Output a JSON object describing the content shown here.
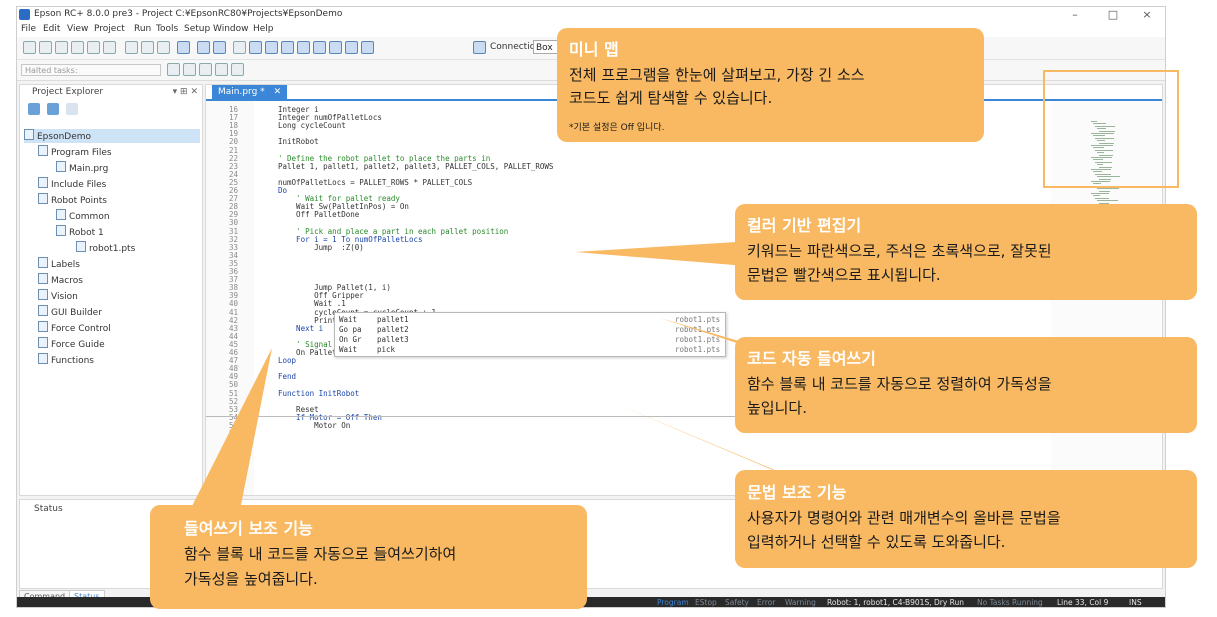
{
  "window": {
    "title": "Epson RC+ 8.0.0 pre3 - Project C:¥EpsonRC80¥Projects¥EpsonDemo",
    "minimize": "–",
    "maximize": "□",
    "close": "×"
  },
  "menu": [
    "File",
    "Edit",
    "View",
    "Project",
    "Run",
    "Tools",
    "Setup",
    "Window",
    "Help"
  ],
  "toolbar": {
    "connection_label": "Connection:",
    "connection_value": "Box"
  },
  "halted_tasks_placeholder": "Halted tasks:",
  "project_explorer": {
    "title": "Project Explorer",
    "pin": "▾ ⊞ ✕",
    "tree": [
      {
        "label": "EpsonDemo"
      },
      {
        "label": "Program Files"
      },
      {
        "label": "Main.prg"
      },
      {
        "label": "Include Files"
      },
      {
        "label": "Robot Points"
      },
      {
        "label": "Common"
      },
      {
        "label": "Robot 1"
      },
      {
        "label": "robot1.pts"
      },
      {
        "label": "Labels"
      },
      {
        "label": "Macros"
      },
      {
        "label": "Vision"
      },
      {
        "label": "GUI Builder"
      },
      {
        "label": "Force Control"
      },
      {
        "label": "Force Guide"
      },
      {
        "label": "Functions"
      }
    ]
  },
  "editor": {
    "tab_label": "Main.prg *",
    "tab_close": "✕",
    "line_numbers": [
      "16",
      "17",
      "18",
      "19",
      "20",
      "21",
      "22",
      "23",
      "24",
      "25",
      "26",
      "27",
      "28",
      "29",
      "30",
      "31",
      "32",
      "33",
      "34",
      "35",
      "36",
      "37",
      "38",
      "39",
      "40",
      "41",
      "42",
      "43",
      "44",
      "45",
      "46",
      "47",
      "48",
      "49",
      "50",
      "51",
      "52",
      "53",
      "54",
      "55",
      "56",
      "57"
    ],
    "lines": [
      {
        "text": "Integer i",
        "kind": "code"
      },
      {
        "text": "Integer numOfPalletLocs",
        "kind": "code"
      },
      {
        "text": "Long cycleCount",
        "kind": "code"
      },
      {
        "text": "",
        "kind": "code"
      },
      {
        "text": "InitRobot",
        "kind": "code"
      },
      {
        "text": "",
        "kind": "code"
      },
      {
        "text": "' Define the robot pallet to place the parts in",
        "kind": "comment"
      },
      {
        "text": "Pallet 1, pallet1, pallet2, pallet3, PALLET_COLS, PALLET_ROWS",
        "kind": "code"
      },
      {
        "text": "",
        "kind": "code"
      },
      {
        "text": "numOfPalletLocs = PALLET_ROWS * PALLET_COLS",
        "kind": "code"
      },
      {
        "text": "Do",
        "kind": "keyword"
      },
      {
        "text": "    ' Wait for pallet ready",
        "kind": "comment"
      },
      {
        "text": "    Wait Sw(PalletInPos) = On",
        "kind": "code"
      },
      {
        "text": "    Off PalletDone",
        "kind": "code"
      },
      {
        "text": "",
        "kind": "code"
      },
      {
        "text": "    ' Pick and place a part in each pallet position",
        "kind": "comment"
      },
      {
        "text": "    For i = 1 To numOfPalletLocs",
        "kind": "keyword"
      },
      {
        "text": "        Jump  :Z(0)",
        "kind": "code"
      },
      {
        "text": "",
        "kind": "code"
      },
      {
        "text": "",
        "kind": "code"
      },
      {
        "text": "",
        "kind": "code"
      },
      {
        "text": "",
        "kind": "code"
      },
      {
        "text": "        Jump Pallet(1, i)",
        "kind": "code"
      },
      {
        "text": "        Off Gripper",
        "kind": "code"
      },
      {
        "text": "        Wait .1",
        "kind": "code"
      },
      {
        "text": "        cycleCount = cycleCount + 1",
        "kind": "code"
      },
      {
        "text": "        Print \"Cycle count: \", cycleCount",
        "kind": "code"
      },
      {
        "text": "    Next i",
        "kind": "keyword"
      },
      {
        "text": "",
        "kind": "code"
      },
      {
        "text": "    ' Signal that the pallet is done",
        "kind": "comment"
      },
      {
        "text": "    On PalletDone",
        "kind": "code"
      },
      {
        "text": "Loop",
        "kind": "keyword"
      },
      {
        "text": "",
        "kind": "code"
      },
      {
        "text": "Fend",
        "kind": "keyword"
      },
      {
        "text": "",
        "kind": "code"
      },
      {
        "text": "Function InitRobot",
        "kind": "keyword"
      },
      {
        "text": "",
        "kind": "code"
      },
      {
        "text": "    Reset",
        "kind": "code"
      },
      {
        "text": "    If Motor = Off Then",
        "kind": "keyword"
      },
      {
        "text": "        Motor On",
        "kind": "code"
      }
    ],
    "intellisense": [
      {
        "kw": "Wait",
        "item": "pallet1",
        "file": "robot1.pts"
      },
      {
        "kw": "Go pa",
        "item": "pallet2",
        "file": "robot1.pts"
      },
      {
        "kw": "On Gr",
        "item": "pallet3",
        "file": "robot1.pts"
      },
      {
        "kw": "Wait",
        "item": "pick",
        "file": "robot1.pts"
      }
    ]
  },
  "status_panel": {
    "title": "Status"
  },
  "bottom_tabs": [
    "Command",
    "Status"
  ],
  "statusbar": {
    "program": "Program",
    "estop": "EStop",
    "safety": "Safety",
    "error": "Error",
    "warning": "Warning",
    "robot": "Robot: 1, robot1, C4-B901S, Dry Run",
    "tasks": "No Tasks Running",
    "position": "Line 33, Col 9",
    "ins": "INS"
  },
  "callouts": {
    "minimap": {
      "title": "미니 맵",
      "body1": "전체 프로그램을 한눈에 살펴보고, 가장 긴 소스",
      "body2": "코드도 쉽게 탐색할 수 있습니다.",
      "note": "*기본 설정은 Off 입니다."
    },
    "color_editor": {
      "title": "컬러 기반 편집기",
      "body1": "키워드는 파란색으로, 주석은 초록색으로, 잘못된",
      "body2": "문법은 빨간색으로 표시됩니다."
    },
    "auto_indent": {
      "title": "코드 자동 들여쓰기",
      "body1": "함수 블록 내 코드를 자동으로 정렬하여 가독성을",
      "body2": "높입니다."
    },
    "syntax_help": {
      "title": "문법 보조 기능",
      "body1": "사용자가 명령어와 관련 매개변수의 올바른 문법을",
      "body2": "입력하거나 선택할 수 있도록 도와줍니다."
    },
    "indent_help": {
      "title": "들여쓰기 보조 기능",
      "body1": "함수 블록 내 코드를 자동으로 들여쓰기하여",
      "body2": "가독성을 높여줍니다."
    }
  },
  "colors": {
    "accent": "#3b86d6",
    "callout": "#f8b962",
    "keyword": "#1b45a8",
    "comment": "#2a8a2a",
    "statusbar": "#2a2a2a"
  }
}
